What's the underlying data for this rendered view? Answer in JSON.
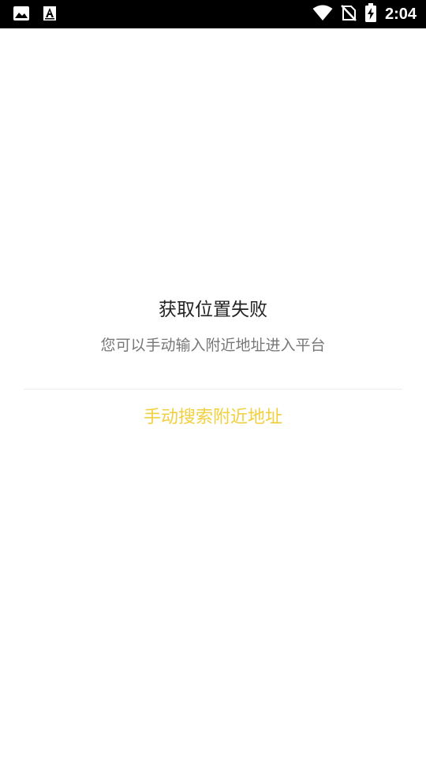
{
  "status_bar": {
    "time": "2:04",
    "icons": [
      "image-icon",
      "text-a-icon",
      "wifi-icon",
      "no-sim-icon",
      "battery-charging-icon"
    ]
  },
  "message": {
    "title": "获取位置失败",
    "subtitle": "您可以手动输入附近地址进入平台"
  },
  "action": {
    "label": "手动搜索附近地址",
    "color": "#f2cf3d"
  }
}
